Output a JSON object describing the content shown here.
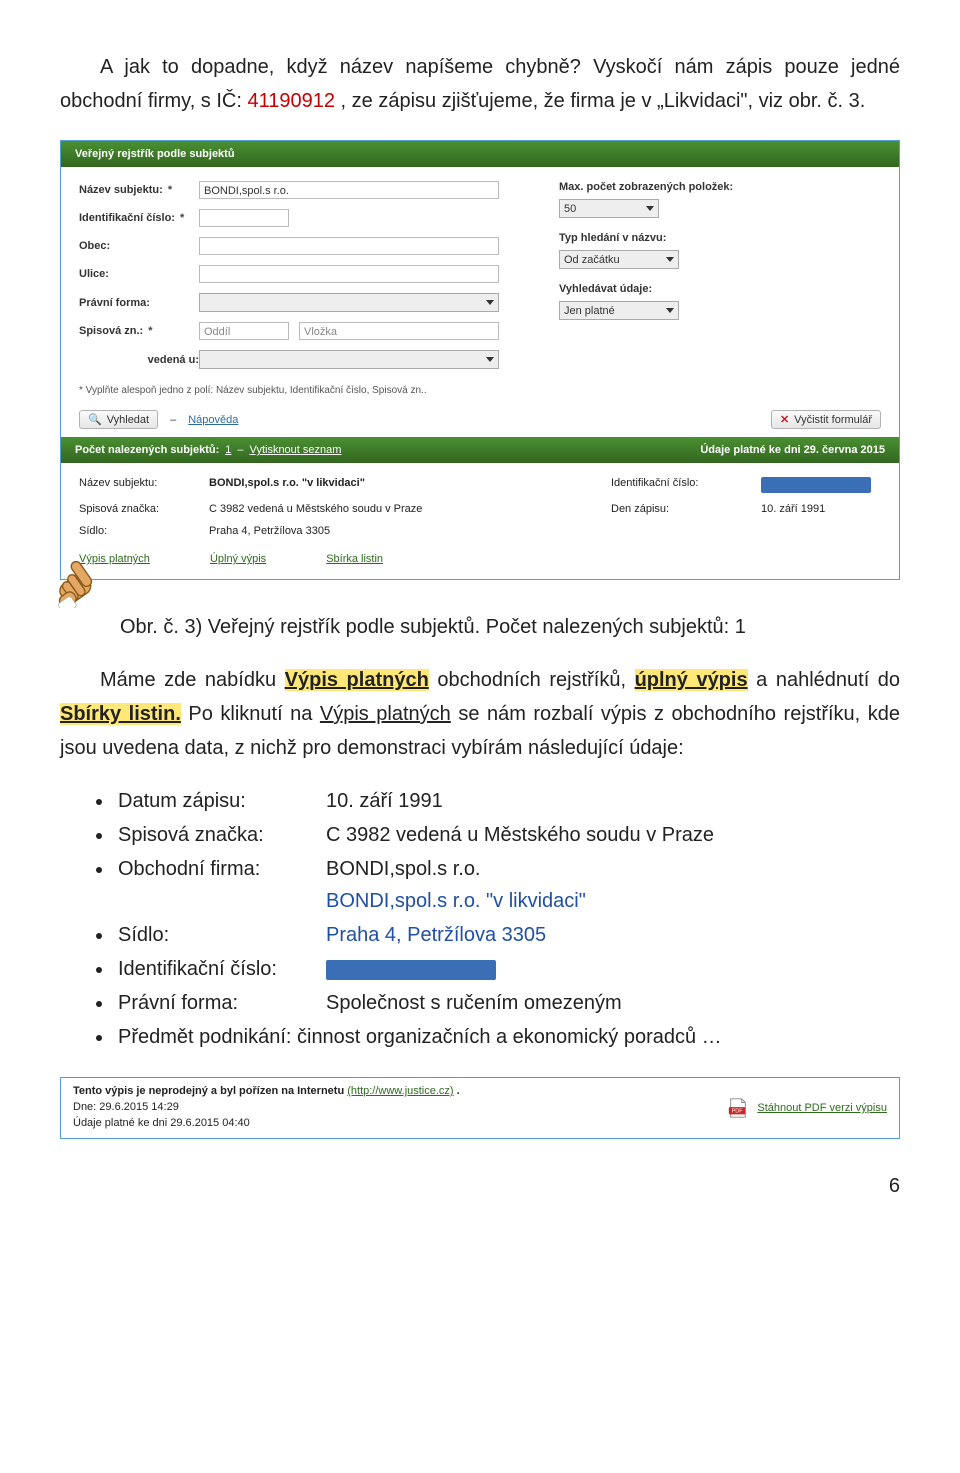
{
  "intro": {
    "para1_pre": "A jak to dopadne, když název napíšeme chybně? Vyskočí nám zápis pouze jedné obchodní firmy, s IČ: ",
    "ic": "41190912",
    "para1_post": ", ze zápisu zjišťujeme, že firma je v „Likvidaci\", viz obr. č. 3."
  },
  "panel": {
    "header": "Veřejný rejstřík podle subjektů",
    "left": {
      "nazev_label": "Název subjektu:",
      "nazev_value": "BONDI,spol.s r.o.",
      "ic_label": "Identifikační číslo:",
      "obec_label": "Obec:",
      "ulice_label": "Ulice:",
      "pravni_label": "Právní forma:",
      "spis_label": "Spisová zn.:",
      "oddil_placeholder": "Oddíl",
      "vlozka_placeholder": "Vložka",
      "vedena_label": "vedená u:"
    },
    "right": {
      "max_label": "Max. počet zobrazených položek:",
      "max_value": "50",
      "typ_label": "Typ hledání v názvu:",
      "typ_value": "Od začátku",
      "vyhl_label": "Vyhledávat údaje:",
      "vyhl_value": "Jen platné"
    },
    "note": "* Vyplňte alespoň jedno z polí: Název subjektu, Identifikační číslo, Spisová zn..",
    "search_btn": "Vyhledat",
    "help_link": "Nápověda",
    "clear_btn": "Vyčistit formulář"
  },
  "result_bar": {
    "count_label": "Počet nalezených subjektů:",
    "count_value": "1",
    "print_link": "Vytisknout seznam",
    "valid": "Údaje platné ke dni 29. června 2015"
  },
  "result": {
    "nazev_lbl": "Název subjektu:",
    "nazev_val": "BONDI,spol.s r.o. \"v likvidaci\"",
    "ic_lbl": "Identifikační číslo:",
    "spis_lbl": "Spisová značka:",
    "spis_val": "C 3982 vedená u Městského soudu v Praze",
    "den_lbl": "Den zápisu:",
    "den_val": "10. září 1991",
    "sidlo_lbl": "Sídlo:",
    "sidlo_val": "Praha 4, Petržílova 3305",
    "links": {
      "l1": "Výpis platných",
      "l2": "Úplný výpis",
      "l3": "Sbírka listin"
    }
  },
  "caption": "Obr. č. 3) Veřejný rejstřík podle subjektů. Počet nalezených subjektů: 1",
  "middle": {
    "p_pre": "Máme zde nabídku ",
    "hl1": "Výpis platných",
    "p_mid1": " obchodních rejstříků, ",
    "hl2": "úplný výpis",
    "p_mid2": " a nahlédnutí do ",
    "hl3": "Sbírky listin.",
    "p_mid3": " Po kliknutí na ",
    "uline": "Výpis platných",
    "p_post": " se nám rozbalí výpis z obchodního rejstříku, kde jsou uvedena data, z nichž pro demonstraci vybírám následující údaje:"
  },
  "bullets": {
    "b1l": "Datum zápisu:",
    "b1v": "10. září 1991",
    "b2l": "Spisová značka:",
    "b2v": "C 3982 vedená u Městského soudu v Praze",
    "b3l": "Obchodní firma:",
    "b3v1": "BONDI,spol.s r.o.",
    "b3v2": "BONDI,spol.s r.o. \"v likvidaci\"",
    "b4l": "Sídlo:",
    "b4v": "Praha 4, Petržílova 3305",
    "b5l": "Identifikační číslo:",
    "b6l": "Právní forma:",
    "b6v": "Společnost s ručením omezeným",
    "b7": "Předmět podnikání: činnost organizačních a ekonomický poradců …"
  },
  "footer": {
    "l1_pre": "Tento výpis je neprodejný a byl pořízen na Internetu ",
    "l1_link": "(http://www.justice.cz)",
    "l1_post": ".",
    "l2": "Dne: 29.6.2015 14:29",
    "l3": "Údaje platné ke dni 29.6.2015 04:40",
    "pdf_link": "Stáhnout PDF verzi výpisu"
  },
  "page_number": "6"
}
